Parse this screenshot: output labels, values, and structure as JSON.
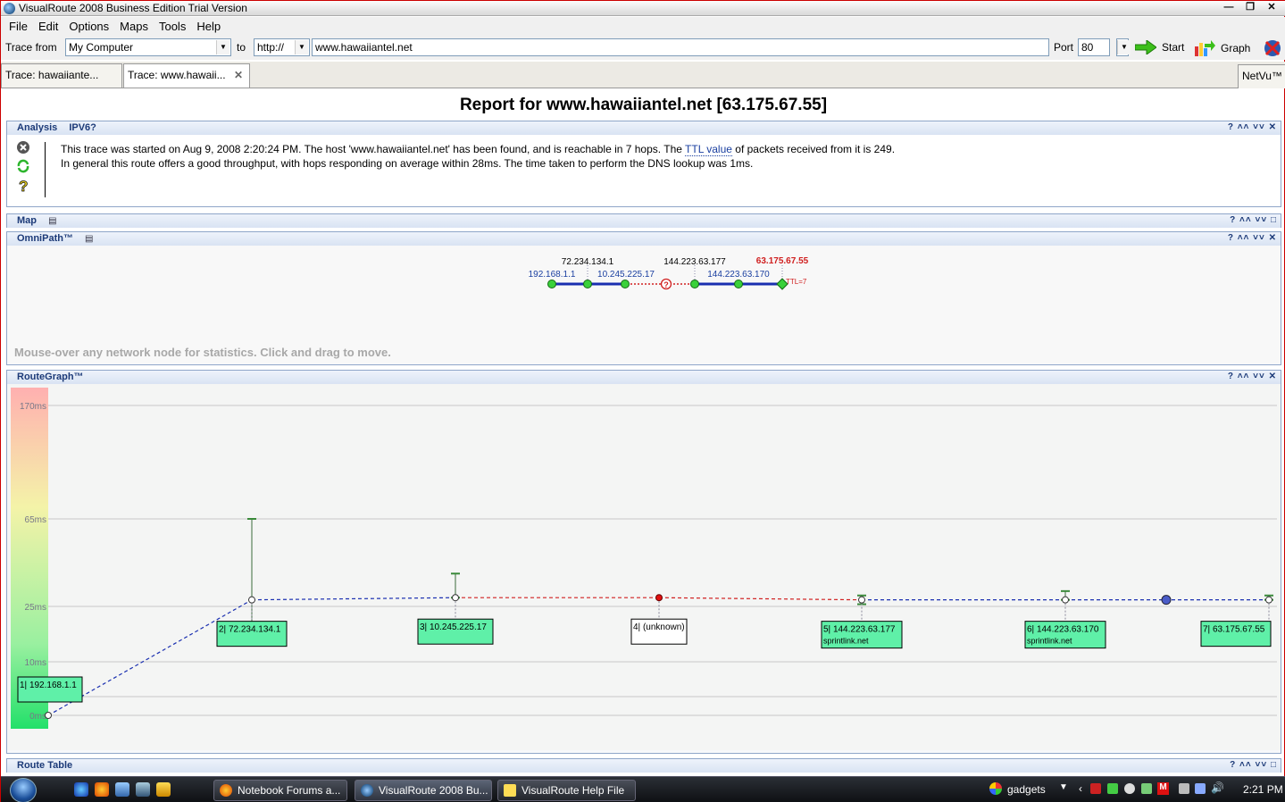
{
  "window": {
    "title": "VisualRoute 2008 Business Edition Trial Version"
  },
  "menu": [
    "File",
    "Edit",
    "Options",
    "Maps",
    "Tools",
    "Help"
  ],
  "tracebar": {
    "trace_from_label": "Trace from",
    "trace_from_value": "My Computer",
    "to_label": "to",
    "protocol": "http://",
    "url": "www.hawaiiantel.net",
    "port_label": "Port",
    "port_value": "80",
    "start_label": "Start",
    "graph_label": "Graph"
  },
  "tabs": [
    {
      "label": "Trace: hawaiiante..."
    },
    {
      "label": "Trace: www.hawaii..."
    }
  ],
  "netvu_label": "NetVu™",
  "report_title": "Report for www.hawaiiantel.net [63.175.67.55]",
  "panels": {
    "analysis": "Analysis",
    "ipv6": "IPV6?",
    "map": "Map",
    "omnipath": "OmniPath™",
    "routegraph": "RouteGraph™",
    "routetable": "Route Table",
    "controls": "? ^ v x"
  },
  "analysis": {
    "line1_a": "This trace was started on Aug 9, 2008 2:20:24 PM. The host 'www.hawaiiantel.net' has been found, and is reachable in 7 hops. The ",
    "line1_link": "TTL value",
    "line1_b": " of packets received from it is 249.",
    "line2": "In general this route offers a good throughput, with hops responding on average within 28ms. The time taken to perform the DNS lookup was 1ms."
  },
  "omnipath": {
    "hint": "Mouse-over any network node for statistics. Click and drag to move.",
    "top_labels": [
      "72.234.134.1",
      "144.223.63.177",
      "63.175.67.55"
    ],
    "bottom_labels": [
      "192.168.1.1",
      "10.245.225.17",
      "144.223.63.170"
    ],
    "ttl": "TTL=7",
    "unknown_marker": "?"
  },
  "chart_data": {
    "type": "line",
    "title": "RouteGraph™",
    "y_ticks": [
      "170ms",
      "65ms",
      "25ms",
      "10ms",
      "0ms"
    ],
    "hops": [
      {
        "label": "1| 192.168.1.1",
        "sub": "",
        "ms": 0
      },
      {
        "label": "2| 72.234.134.1",
        "sub": "",
        "ms": 28
      },
      {
        "label": "3| 10.245.225.17",
        "sub": "",
        "ms": 29
      },
      {
        "label": "4| (unknown)",
        "sub": "",
        "ms": 29
      },
      {
        "label": "5| 144.223.63.177",
        "sub": "sprintlink.net",
        "ms": 28
      },
      {
        "label": "6| 144.223.63.170",
        "sub": "sprintlink.net",
        "ms": 28
      },
      {
        "label": "7| 63.175.67.55",
        "sub": "",
        "ms": 28
      }
    ],
    "colors": {
      "normal_link": "#1a2fb0",
      "unknown_link": "#d02020",
      "box_fill": "#5ff0a8",
      "unknown_box": "#ffffff"
    }
  },
  "taskbar": {
    "tasks": [
      "Notebook Forums a...",
      "VisualRoute 2008 Bu...",
      "VisualRoute Help File"
    ],
    "tray_label": "gadgets",
    "clock": "2:21 PM"
  }
}
